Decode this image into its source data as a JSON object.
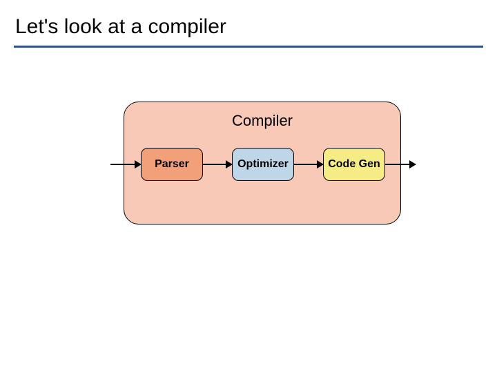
{
  "slide": {
    "title": "Let's look at a compiler"
  },
  "diagram": {
    "container_label": "Compiler",
    "stages": {
      "parser": "Parser",
      "optimizer": "Optimizer",
      "codegen": "Code\nGen"
    }
  }
}
